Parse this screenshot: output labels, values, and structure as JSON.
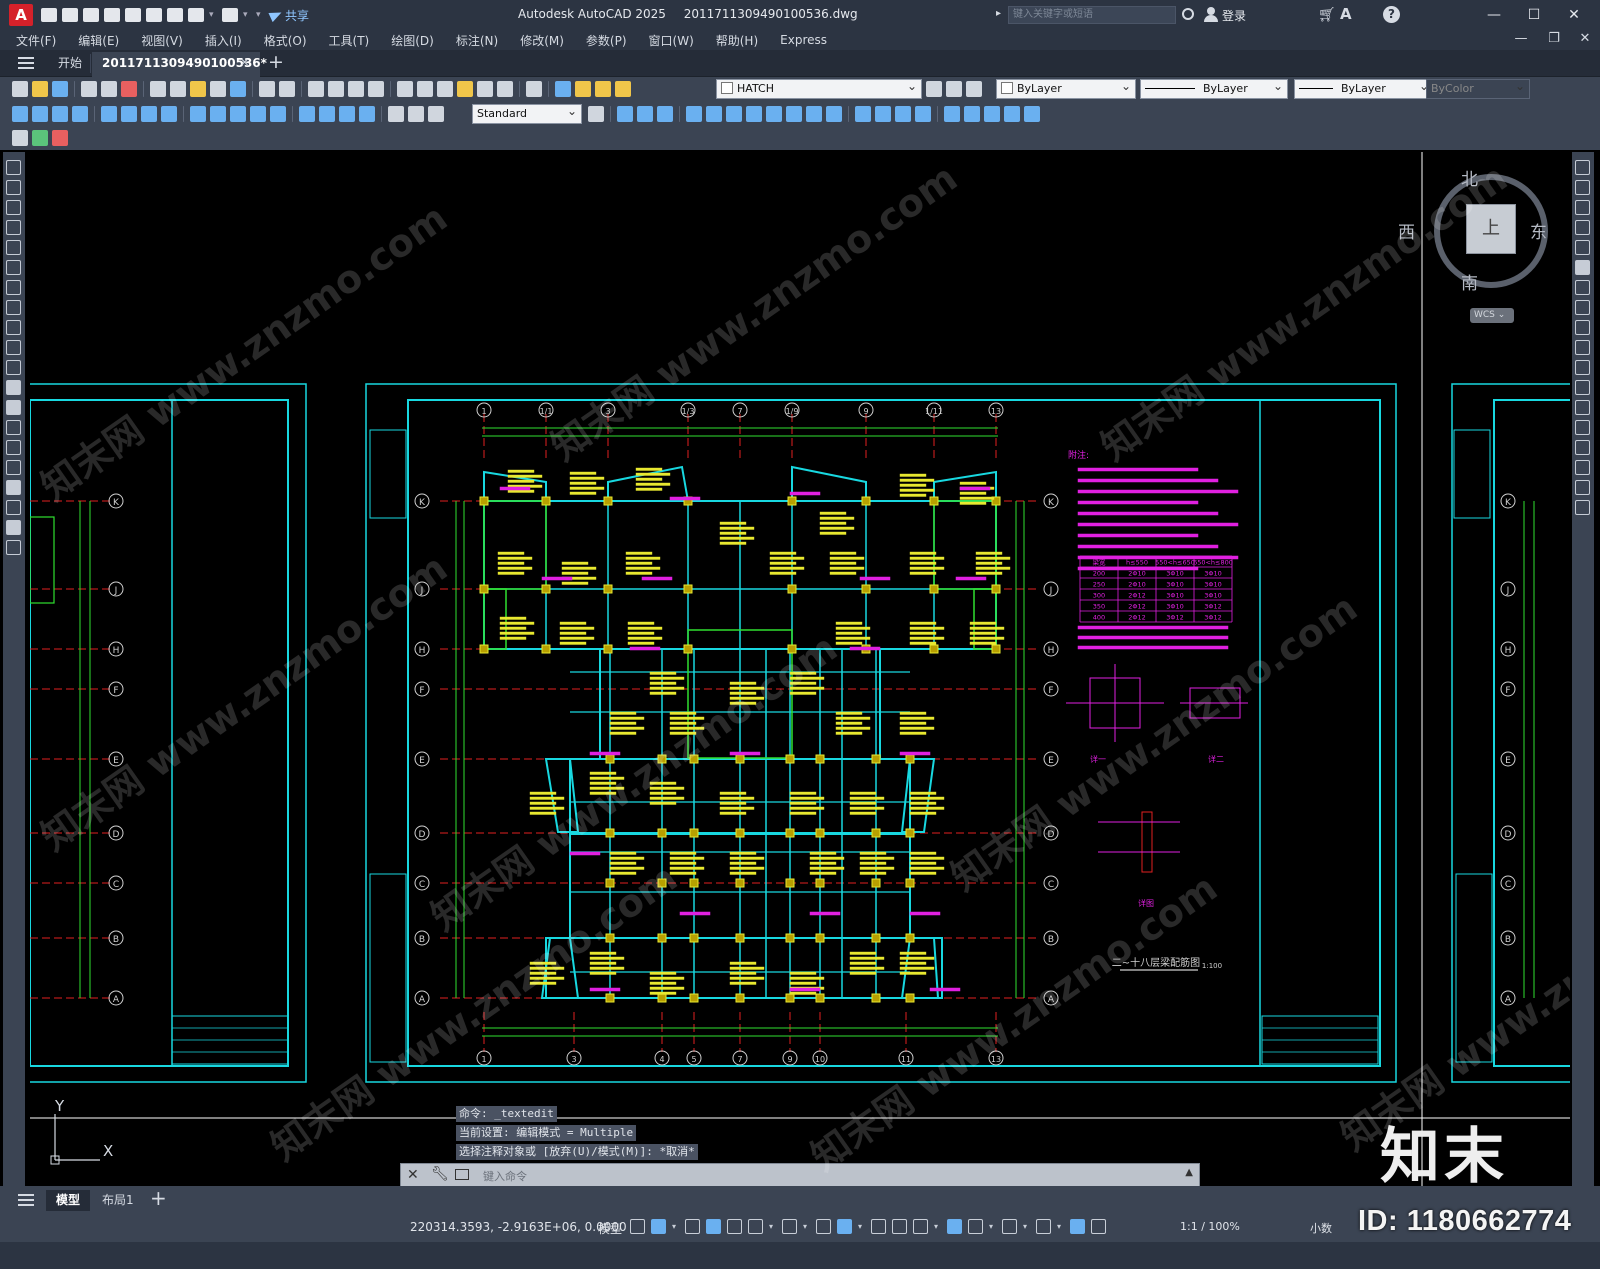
{
  "titlebar": {
    "app_logo": "A",
    "share_label": "共享",
    "app_name": "Autodesk AutoCAD 2025",
    "file_name": "2011711309490100536.dwg",
    "search_placeholder": "键入关键字或短语",
    "login_label": "登录",
    "minimize": "—",
    "maximize": "☐",
    "close": "✕"
  },
  "menubar": {
    "items": [
      "文件(F)",
      "编辑(E)",
      "视图(V)",
      "插入(I)",
      "格式(O)",
      "工具(T)",
      "绘图(D)",
      "标注(N)",
      "修改(M)",
      "参数(P)",
      "窗口(W)",
      "帮助(H)",
      "Express"
    ]
  },
  "tabs": {
    "start_label": "开始",
    "doc_label": "2011711309490100536*",
    "close_glyph": "✕",
    "new_glyph": "+"
  },
  "toolbar": {
    "layer_name": "HATCH",
    "color": "ByLayer",
    "linetype": "ByLayer",
    "lineweight": "ByLayer",
    "plotstyle": "ByColor",
    "text_style": "Standard"
  },
  "viewcube": {
    "north": "北",
    "south": "南",
    "east": "东",
    "west": "西",
    "face": "上",
    "wcs": "WCS ⌄"
  },
  "ucs": {
    "x": "X",
    "y": "Y"
  },
  "command": {
    "history": [
      "命令: _textedit",
      "当前设置: 编辑模式 = Multiple",
      "选择注释对象或 [放弃(U)/模式(M)]: *取消*"
    ],
    "placeholder": "键入命令"
  },
  "drawing": {
    "grid_top": [
      "1",
      "1/1",
      "3",
      "1/3",
      "7",
      "1/9",
      "9",
      "1/11",
      "13"
    ],
    "grid_bottom": [
      "1",
      "3",
      "4",
      "5",
      "7",
      "9",
      "10",
      "11",
      "13"
    ],
    "grid_rows": [
      "K",
      "J",
      "H",
      "F",
      "E",
      "D",
      "C",
      "B",
      "A"
    ],
    "drawing_title": "二~十八层梁配筋图",
    "drawing_scale": "1:100",
    "notes_title": "附注:",
    "table_headers": [
      "梁宽",
      "h≤550",
      "550<h≤650",
      "650<h≤800"
    ],
    "table_rows": [
      [
        "200",
        "2Φ10",
        "3Φ10",
        "3Φ10"
      ],
      [
        "250",
        "2Φ10",
        "3Φ10",
        "3Φ10"
      ],
      [
        "300",
        "2Φ12",
        "3Φ10",
        "3Φ10"
      ],
      [
        "350",
        "2Φ12",
        "3Φ10",
        "3Φ12"
      ],
      [
        "400",
        "2Φ12",
        "3Φ12",
        "3Φ12"
      ]
    ],
    "detail_labels": [
      "详一",
      "详二",
      "详图"
    ]
  },
  "watermark": {
    "text": "知末网 www.znzmo.com",
    "brand": "知末",
    "id": "ID: 1180662774"
  },
  "layout_tabs": {
    "model": "模型",
    "layout1": "布局1",
    "plus": "+"
  },
  "statusbar": {
    "coordinates": "220314.3593, -2.9163E+06, 0.0000",
    "space": "模型",
    "scale": "1:1 / 100%",
    "units": "小数"
  }
}
